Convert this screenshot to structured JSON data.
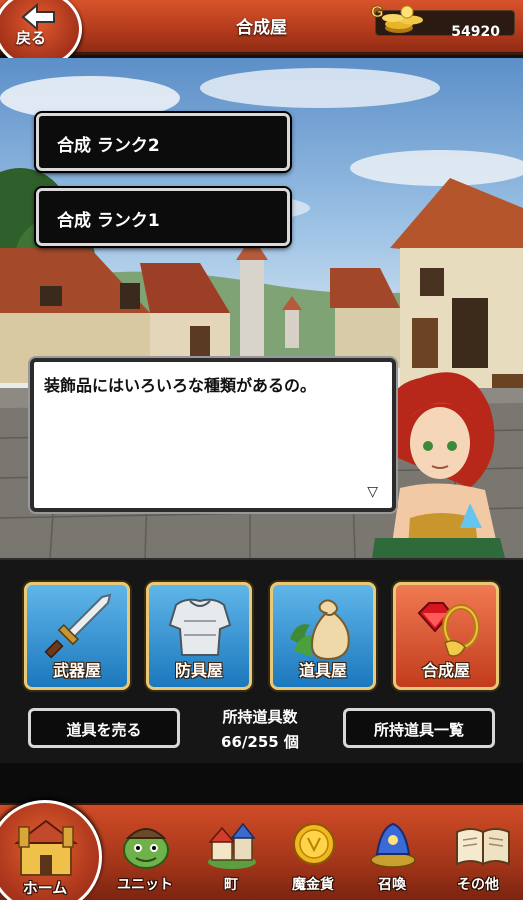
{
  "header": {
    "title": "合成屋",
    "back_label": "戻る",
    "gold_icon_label": "G",
    "gold_amount": "54920"
  },
  "synthesis": {
    "rank_buttons": [
      {
        "label": "合成 ランク2"
      },
      {
        "label": "合成 ランク1"
      }
    ]
  },
  "dialog": {
    "text": "装飾品にはいろいろな種類があるの。",
    "next_indicator": "▽"
  },
  "shops": [
    {
      "label": "武器屋",
      "icon": "sword-icon"
    },
    {
      "label": "防具屋",
      "icon": "armor-icon"
    },
    {
      "label": "道具屋",
      "icon": "item-bag-icon"
    },
    {
      "label": "合成屋",
      "icon": "jewel-ring-icon"
    }
  ],
  "actions": {
    "sell_label": "道具を売る",
    "inventory_title": "所持道具数",
    "inventory_count": "66/255 個",
    "inventory_list_label": "所持道具一覧"
  },
  "nav": [
    {
      "label": "ホーム",
      "icon": "home-icon"
    },
    {
      "label": "ユニット",
      "icon": "unit-icon"
    },
    {
      "label": "町",
      "icon": "town-icon"
    },
    {
      "label": "魔金貨",
      "icon": "gold-coin-icon"
    },
    {
      "label": "召喚",
      "icon": "summon-icon"
    },
    {
      "label": "その他",
      "icon": "book-icon"
    }
  ],
  "colors": {
    "header_red": "#b23a1c",
    "shop_blue": "#1c78bd",
    "shop_active_red": "#c23c1c",
    "button_border_gold": "#e9c977"
  }
}
